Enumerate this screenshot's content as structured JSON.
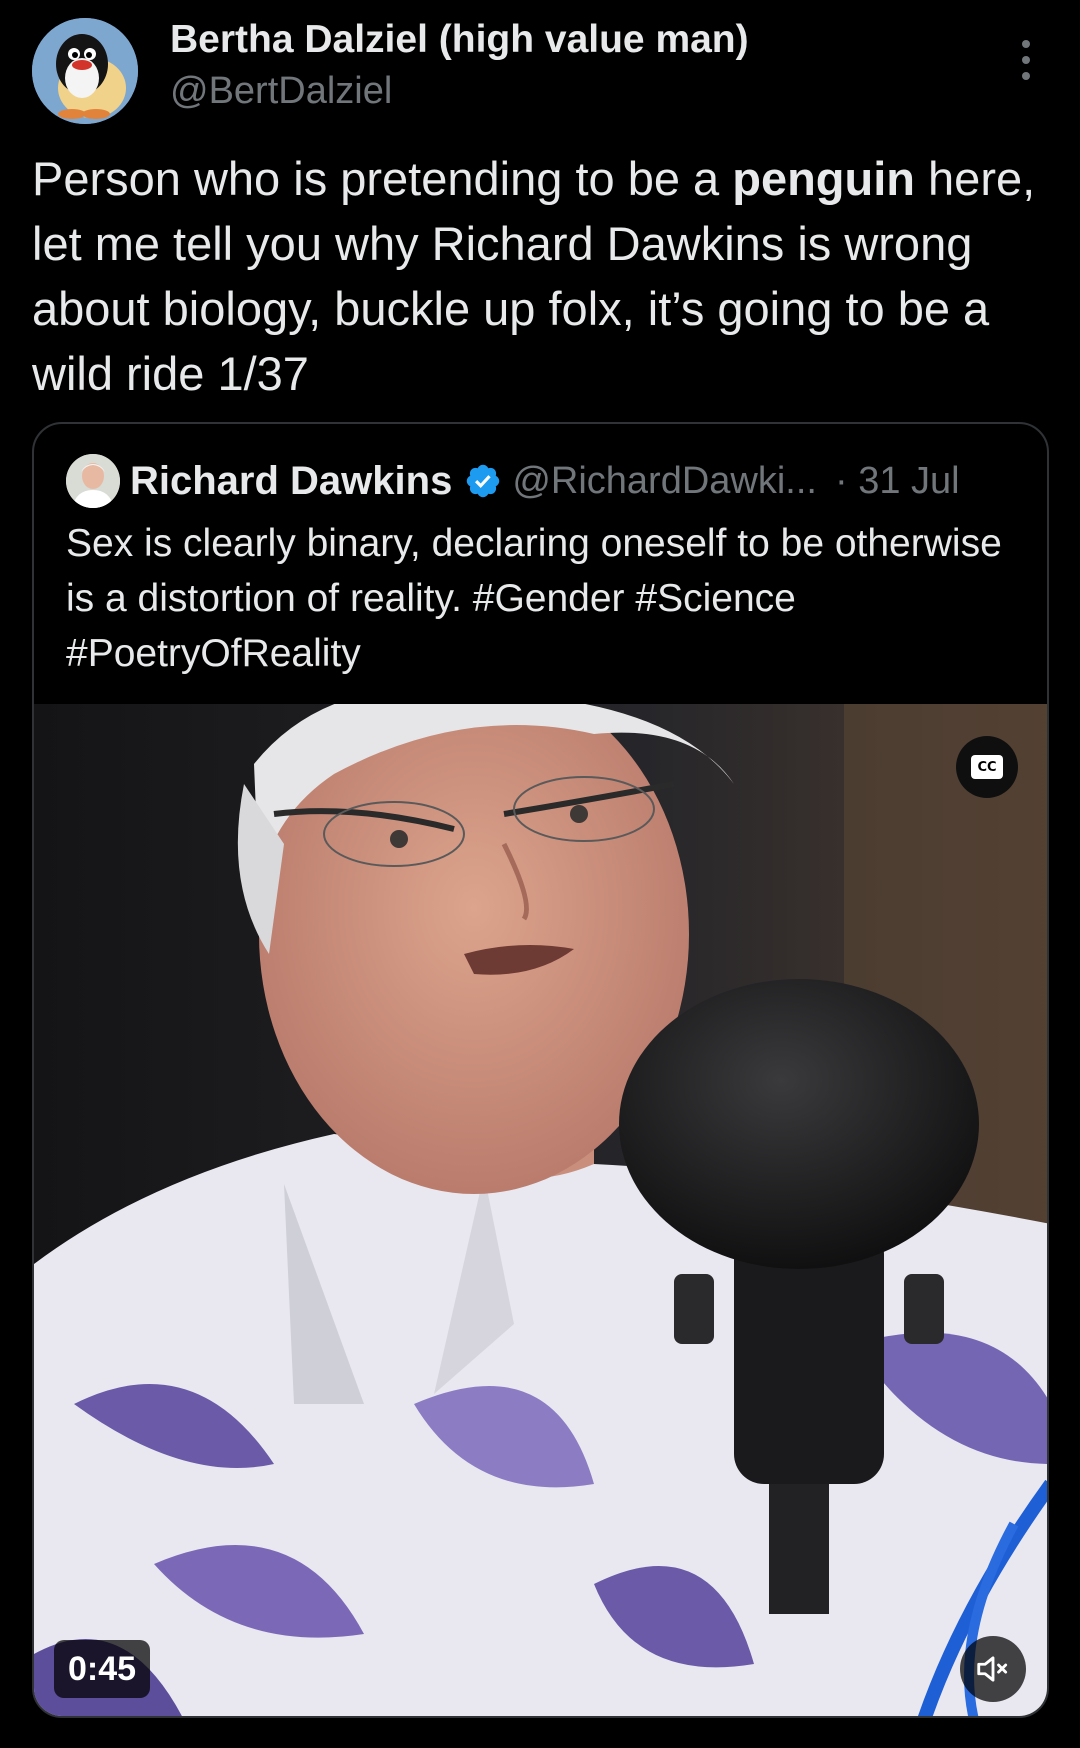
{
  "tweet": {
    "author": {
      "name": "Bertha Dalziel (high value man)",
      "handle": "@BertDalziel"
    },
    "text_parts": {
      "before": "Person who is pretending to be a ",
      "bold": "penguin",
      "after": " here, let me tell you why Richard Dawkins is wrong about biology, buckle up folx, it’s going to be a wild ride 1/37"
    }
  },
  "quote": {
    "author": {
      "name": "Richard Dawkins",
      "handle": "@RichardDawki...",
      "date": "· 31 Jul"
    },
    "text": "Sex is clearly binary, declaring oneself to be otherwise is a distortion of reality. #Gender #Science #PoetryOfReality",
    "video": {
      "duration": "0:45",
      "cc_label": "CC",
      "muted": true
    }
  },
  "icons": {
    "more": "more-options-icon",
    "verified": "verified-badge-icon",
    "captions": "closed-captions-icon",
    "mute": "volume-muted-icon"
  },
  "colors": {
    "background": "#000000",
    "text_primary": "#e7e9ea",
    "text_secondary": "#71767b",
    "border": "#2f3336",
    "verified_blue": "#1d9bf0"
  }
}
